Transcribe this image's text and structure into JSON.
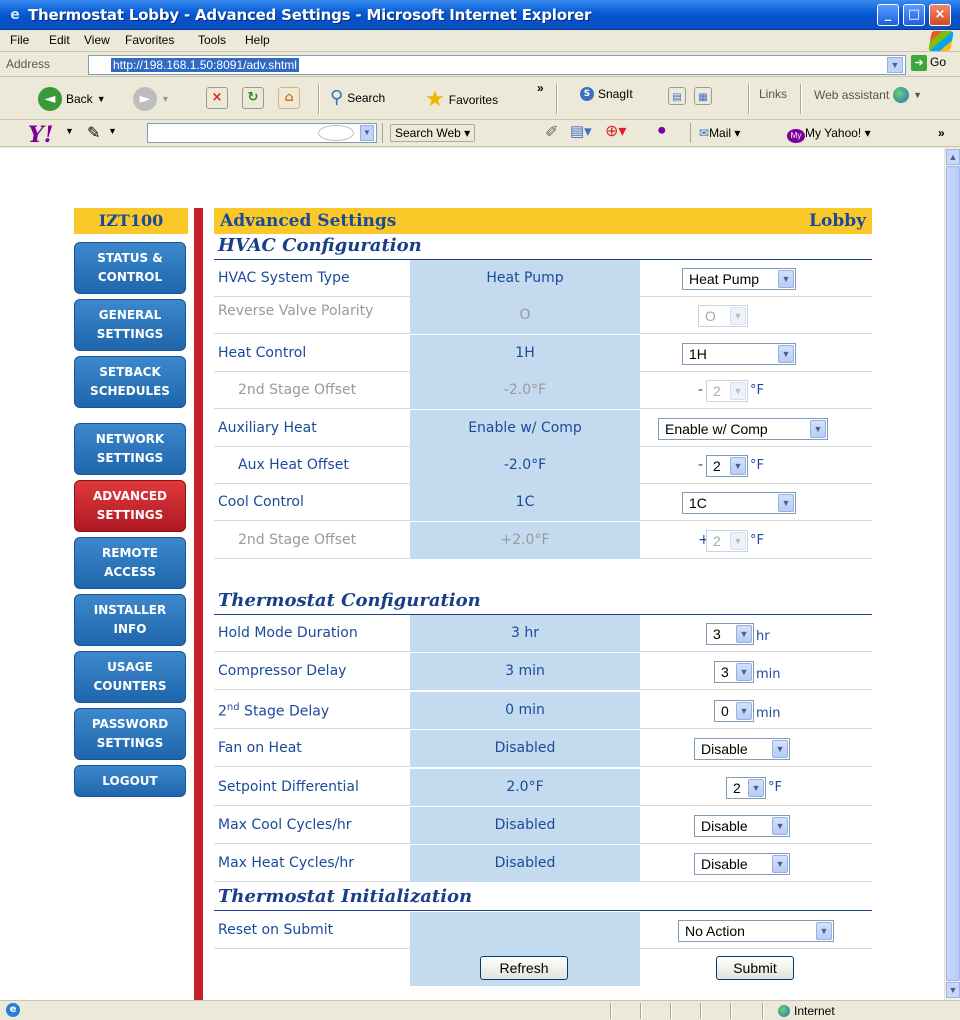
{
  "window": {
    "title": "Thermostat Lobby - Advanced Settings - Microsoft Internet Explorer"
  },
  "menu": [
    "File",
    "Edit",
    "View",
    "Favorites",
    "Tools",
    "Help"
  ],
  "address": {
    "label": "Address",
    "url": "http://198.168.1.50:8091/adv.shtml",
    "go": "Go"
  },
  "toolbar": {
    "back": "Back",
    "search": "Search",
    "favorites": "Favorites",
    "snagit": "SnagIt",
    "links": "Links",
    "web_assistant": "Web assistant"
  },
  "yahoo_bar": {
    "logo": "Y!",
    "search_web": "Search Web",
    "mail": "Mail",
    "my_yahoo": "My Yahoo!"
  },
  "status_bar": {
    "zone": "Internet"
  },
  "brand": "IZT100",
  "nav": [
    {
      "label": "Status & Control",
      "active": false
    },
    {
      "label": "General Settings",
      "active": false
    },
    {
      "label": "Setback Schedules",
      "active": false
    },
    {
      "label": "Network Settings",
      "active": false
    },
    {
      "label": "Advanced Settings",
      "active": true
    },
    {
      "label": "Remote Access",
      "active": false
    },
    {
      "label": "Installer Info",
      "active": false
    },
    {
      "label": "Usage Counters",
      "active": false
    },
    {
      "label": "Password Settings",
      "active": false
    },
    {
      "label": "Logout",
      "active": false
    }
  ],
  "page": {
    "title": "Advanced Settings",
    "location": "Lobby",
    "sections": {
      "hvac": "HVAC Configuration",
      "thermostat": "Thermostat Configuration",
      "init": "Thermostat Initialization"
    }
  },
  "hvac_rows": [
    {
      "label": "HVAC System Type",
      "current": "Heat Pump",
      "select": "Heat Pump",
      "disabled": false
    },
    {
      "label": "Reverse Valve Polarity",
      "current": "O",
      "select": "O",
      "disabled": true
    },
    {
      "label": "Heat Control",
      "current": "1H",
      "select": "1H",
      "disabled": false
    },
    {
      "label": "2nd Stage Offset",
      "current": "-2.0°F",
      "prefix": "-",
      "select": "2",
      "unit": "°F",
      "disabled": true
    },
    {
      "label": "Auxiliary Heat",
      "current": "Enable w/ Comp",
      "select": "Enable w/ Comp",
      "disabled": false
    },
    {
      "label": "Aux Heat Offset",
      "current": "-2.0°F",
      "prefix": "-",
      "select": "2",
      "unit": "°F",
      "disabled": false
    },
    {
      "label": "Cool Control",
      "current": "1C",
      "select": "1C",
      "disabled": false
    },
    {
      "label": "2nd Stage Offset",
      "current": "+2.0°F",
      "prefix": "+",
      "select": "2",
      "unit": "°F",
      "disabled": true
    }
  ],
  "thermo_rows": [
    {
      "label": "Hold Mode Duration",
      "current": "3 hr",
      "select": "3",
      "unit": "hr"
    },
    {
      "label": "Compressor Delay",
      "current": "3 min",
      "select": "3",
      "unit": "min"
    },
    {
      "label_main": "2",
      "label_sup": "nd",
      "label_rest": " Stage Delay",
      "current": "0 min",
      "select": "0",
      "unit": "min"
    },
    {
      "label": "Fan on Heat",
      "current": "Disabled",
      "select": "Disable"
    },
    {
      "label": "Setpoint Differential",
      "current": "2.0°F",
      "select": "2",
      "unit": "°F"
    },
    {
      "label": "Max Cool Cycles/hr",
      "current": "Disabled",
      "select": "Disable"
    },
    {
      "label": "Max Heat Cycles/hr",
      "current": "Disabled",
      "select": "Disable"
    }
  ],
  "init_rows": [
    {
      "label": "Reset on Submit",
      "select": "No Action"
    }
  ],
  "buttons": {
    "refresh": "Refresh",
    "submit": "Submit"
  }
}
